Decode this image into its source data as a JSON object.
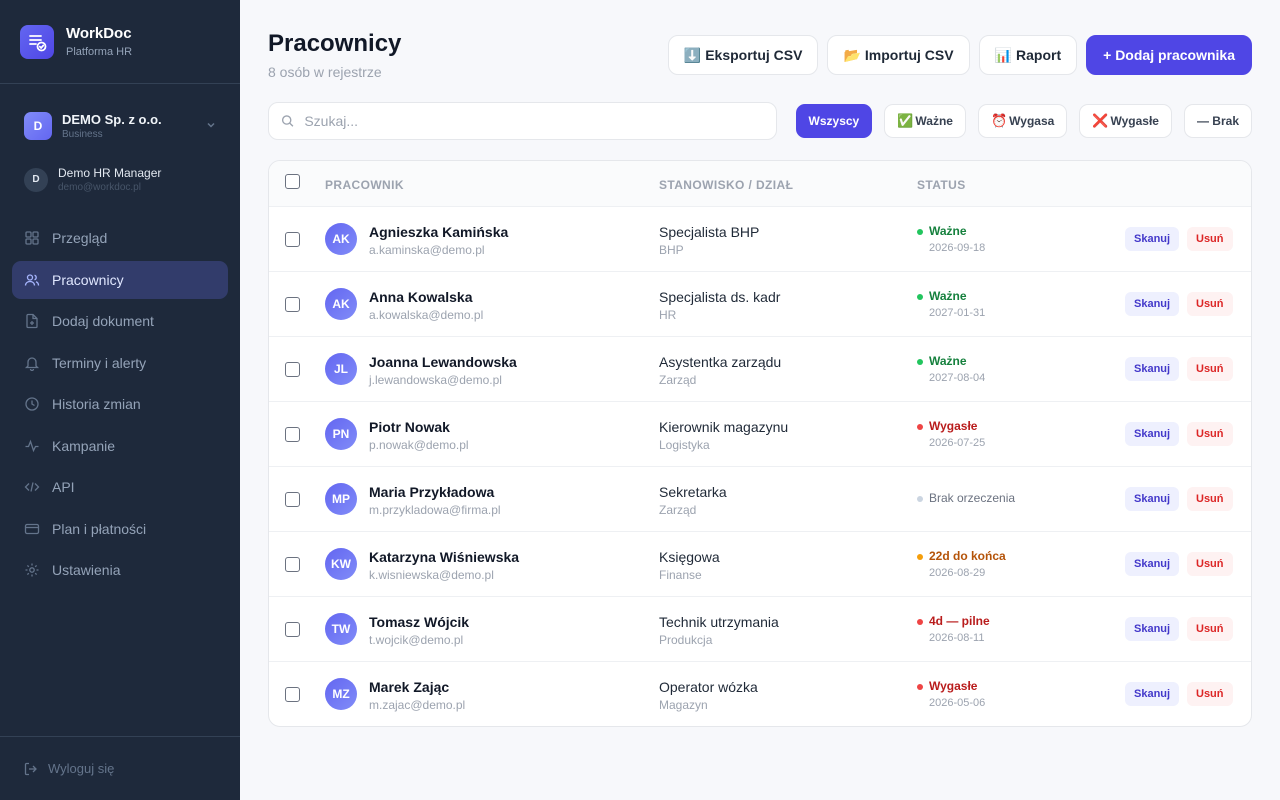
{
  "brand": {
    "name": "WorkDoc",
    "subtitle": "Platforma HR",
    "logo_icon": "document-check-icon"
  },
  "organization": {
    "initial": "D",
    "name": "DEMO Sp. z o.o.",
    "plan": "Business"
  },
  "user": {
    "initial": "D",
    "name": "Demo HR Manager",
    "email": "demo@workdoc.pl"
  },
  "nav": {
    "items": [
      {
        "label": "Przegląd",
        "icon": "grid-icon"
      },
      {
        "label": "Pracownicy",
        "icon": "users-icon",
        "active": true
      },
      {
        "label": "Dodaj dokument",
        "icon": "file-plus-icon"
      },
      {
        "label": "Terminy i alerty",
        "icon": "bell-icon"
      },
      {
        "label": "Historia zmian",
        "icon": "clock-icon"
      },
      {
        "label": "Kampanie",
        "icon": "activity-icon"
      },
      {
        "label": "API",
        "icon": "code-icon"
      },
      {
        "label": "Plan i płatności",
        "icon": "credit-card-icon"
      },
      {
        "label": "Ustawienia",
        "icon": "gear-icon"
      }
    ],
    "logout": "Wyloguj się"
  },
  "header": {
    "title": "Pracownicy",
    "subtitle": "8 osób w rejestrze"
  },
  "actions": {
    "export": {
      "emoji": "⬇️",
      "label": "Eksportuj CSV"
    },
    "import": {
      "emoji": "📂",
      "label": "Importuj CSV"
    },
    "report": {
      "emoji": "📊",
      "label": "Raport"
    },
    "add": "+ Dodaj pracownika"
  },
  "search": {
    "placeholder": "Szukaj...",
    "value": ""
  },
  "filters": {
    "all": {
      "label": "Wszyscy"
    },
    "valid": {
      "emoji": "✅",
      "label": "Ważne"
    },
    "expiring": {
      "emoji": "⏰",
      "label": "Wygasa"
    },
    "expired": {
      "emoji": "❌",
      "label": "Wygasłe"
    },
    "none": {
      "label": "— Brak"
    }
  },
  "table": {
    "columns": {
      "employee": "PRACOWNIK",
      "position": "STANOWISKO / DZIAŁ",
      "status": "STATUS"
    },
    "scan_label": "Skanuj",
    "delete_label": "Usuń",
    "rows": [
      {
        "initials": "AK",
        "name": "Agnieszka Kamińska",
        "email": "a.kaminska@demo.pl",
        "position": "Specjalista BHP",
        "department": "BHP",
        "status": "Ważne",
        "status_type": "ok",
        "date": "2026-09-18"
      },
      {
        "initials": "AK",
        "name": "Anna Kowalska",
        "email": "a.kowalska@demo.pl",
        "position": "Specjalista ds. kadr",
        "department": "HR",
        "status": "Ważne",
        "status_type": "ok",
        "date": "2027-01-31"
      },
      {
        "initials": "JL",
        "name": "Joanna Lewandowska",
        "email": "j.lewandowska@demo.pl",
        "position": "Asystentka zarządu",
        "department": "Zarząd",
        "status": "Ważne",
        "status_type": "ok",
        "date": "2027-08-04"
      },
      {
        "initials": "PN",
        "name": "Piotr Nowak",
        "email": "p.nowak@demo.pl",
        "position": "Kierownik magazynu",
        "department": "Logistyka",
        "status": "Wygasłe",
        "status_type": "bad",
        "date": "2026-07-25"
      },
      {
        "initials": "MP",
        "name": "Maria Przykładowa",
        "email": "m.przykladowa@firma.pl",
        "position": "Sekretarka",
        "department": "Zarząd",
        "status": "Brak orzeczenia",
        "status_type": "none",
        "date": ""
      },
      {
        "initials": "KW",
        "name": "Katarzyna Wiśniewska",
        "email": "k.wisniewska@demo.pl",
        "position": "Księgowa",
        "department": "Finanse",
        "status": "22d do końca",
        "status_type": "warn",
        "date": "2026-08-29"
      },
      {
        "initials": "TW",
        "name": "Tomasz Wójcik",
        "email": "t.wojcik@demo.pl",
        "position": "Technik utrzymania",
        "department": "Produkcja",
        "status": "4d — pilne",
        "status_type": "bad",
        "date": "2026-08-11"
      },
      {
        "initials": "MZ",
        "name": "Marek Zając",
        "email": "m.zajac@demo.pl",
        "position": "Operator wózka",
        "department": "Magazyn",
        "status": "Wygasłe",
        "status_type": "bad",
        "date": "2026-05-06"
      }
    ]
  },
  "colors": {
    "accent": "#4f46e5",
    "sidebar": "#1e293b",
    "ok": "#15803d",
    "bad": "#b91c1c",
    "warn": "#b45309"
  }
}
